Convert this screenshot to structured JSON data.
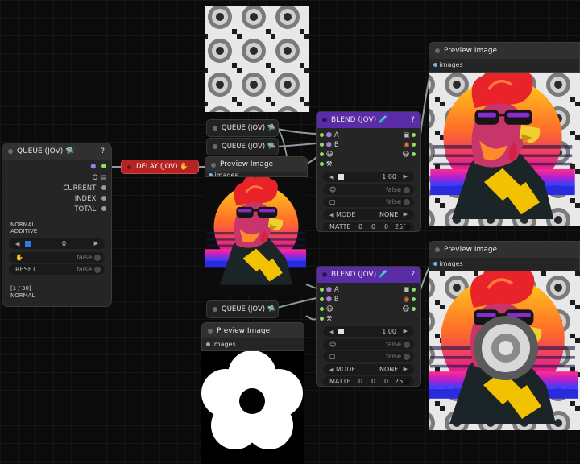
{
  "colors": {
    "canvas": "#0b0b0b",
    "node_bg": "#252525",
    "delay_node": "#b52424",
    "blend_title": "#5b2ca8",
    "link": "#a8b4bf"
  },
  "queue_main": {
    "title": "QUEUE (JOV) 🛸",
    "help": "?",
    "outputs": [
      "Q",
      "CURRENT",
      "INDEX",
      "TOTAL"
    ],
    "mode_lines": [
      "NORMAL",
      "ADDITIVE"
    ],
    "index_value": "0",
    "stop_value": "false",
    "reset_label": "RESET",
    "reset_value": "false",
    "footer_count": "[1 / 30]",
    "footer_mode": "NORMAL"
  },
  "delay": {
    "title": "DELAY (JOV) ✋"
  },
  "queue_small": [
    {
      "title": "QUEUE (JOV) 🛸"
    },
    {
      "title": "QUEUE (JOV) 🛸"
    },
    {
      "title": "QUEUE (JOV) 🛸"
    }
  ],
  "preview": {
    "title": "Preview Image",
    "input_label": "images"
  },
  "blend": {
    "title": "BLEND (JOV) 🧪",
    "help": "?",
    "input_a": "A",
    "input_b": "B",
    "alpha_value": "1.00",
    "flip_value": "false",
    "invert_value": "false",
    "mode_label": "MODE",
    "mode_value": "NONE",
    "matte_label": "MATTE",
    "matte_values": [
      "0",
      "0",
      "0",
      "255"
    ]
  }
}
